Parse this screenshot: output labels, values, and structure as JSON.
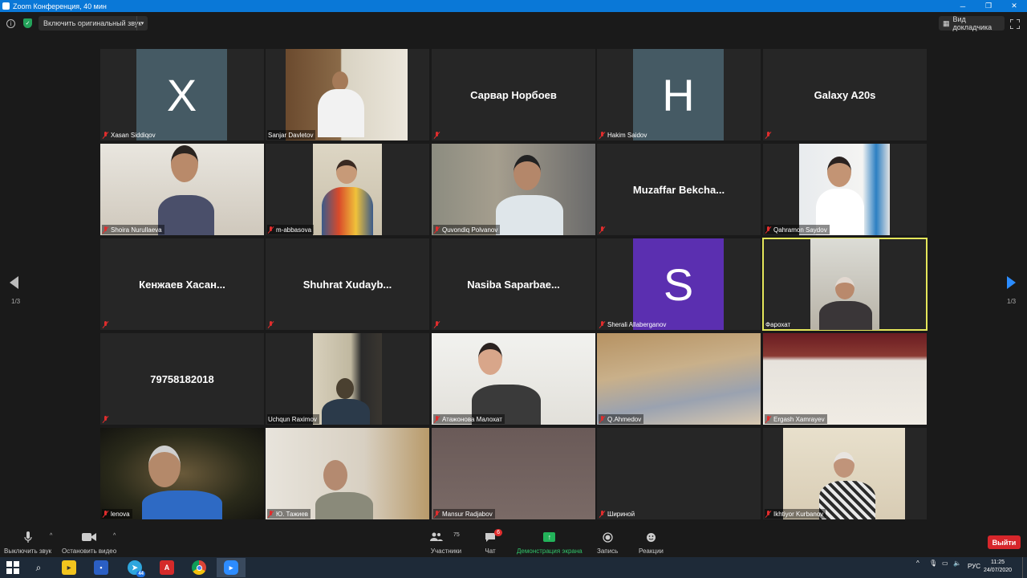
{
  "window": {
    "title": "Zoom Конференция, 40 мин"
  },
  "top_bar": {
    "original_sound_label": "Включить оригинальный звук",
    "view_label": "Вид докладчика"
  },
  "pagination": {
    "left": "1/3",
    "right": "1/3"
  },
  "participants": [
    {
      "name": "Xasan Siddiqov",
      "mode": "avatar",
      "initial": "X",
      "avatar_color": "#455a64",
      "muted": true
    },
    {
      "name": "Sanjar Davletov",
      "mode": "video",
      "muted": false
    },
    {
      "name": "",
      "mode": "name",
      "display": "Сарвар Норбоев",
      "muted": true
    },
    {
      "name": "Hakim Saidov",
      "mode": "avatar",
      "initial": "H",
      "avatar_color": "#455a64",
      "muted": true
    },
    {
      "name": "",
      "mode": "name",
      "display": "Galaxy A20s",
      "muted": true
    },
    {
      "name": "Shoira Nurullaeva",
      "mode": "video",
      "muted": true
    },
    {
      "name": "m-abbasova",
      "mode": "video",
      "muted": true
    },
    {
      "name": "Quvondiq Polvanov",
      "mode": "video",
      "muted": true
    },
    {
      "name": "",
      "mode": "name",
      "display": "Muzaffar  Bekcha...",
      "muted": true
    },
    {
      "name": "Qahramon Saydov",
      "mode": "video",
      "muted": true
    },
    {
      "name": "",
      "mode": "name",
      "display": "Кенжаев  Хасан...",
      "muted": true
    },
    {
      "name": "",
      "mode": "name",
      "display": "Shuhrat  Xudayb...",
      "muted": true
    },
    {
      "name": "",
      "mode": "name",
      "display": "Nasiba  Saparbae...",
      "muted": true
    },
    {
      "name": "Sherali Allaberganov",
      "mode": "avatar",
      "initial": "S",
      "avatar_color": "#5b2fb0",
      "muted": true
    },
    {
      "name": "Фарохат",
      "mode": "video",
      "muted": false,
      "active_speaker": true
    },
    {
      "name": "",
      "mode": "name",
      "display": "79758182018",
      "muted": true
    },
    {
      "name": "Uchqun Raximov",
      "mode": "video",
      "muted": false
    },
    {
      "name": "Атажонова Малохат",
      "mode": "video",
      "muted": true
    },
    {
      "name": "Q.Ahmedov",
      "mode": "video",
      "muted": true
    },
    {
      "name": "Ergash Xamrayev",
      "mode": "video",
      "muted": true
    },
    {
      "name": "lenova",
      "mode": "video",
      "muted": true
    },
    {
      "name": "Ю. Тажиев",
      "mode": "video",
      "muted": true
    },
    {
      "name": "Mansur Radjabov",
      "mode": "video",
      "muted": true
    },
    {
      "name": "Шириной",
      "mode": "video",
      "muted": true
    },
    {
      "name": "Ikhtiyor Kurbanov",
      "mode": "video",
      "muted": true
    }
  ],
  "toolbar": {
    "mute_label": "Выключить звук",
    "video_label": "Остановить видео",
    "participants_label": "Участники",
    "participants_count": "75",
    "chat_label": "Чат",
    "chat_badge": "6",
    "share_label": "Демонстрация экрана",
    "record_label": "Запись",
    "reactions_label": "Реакции",
    "leave_label": "Выйти"
  },
  "taskbar": {
    "telegram_badge": "44",
    "language": "РУС",
    "time": "11:25",
    "date": "24/07/2020"
  },
  "colors": {
    "accent": "#2b8cff",
    "speaker_highlight": "#e4e65a",
    "leave": "#d7262b",
    "share": "#23b35a"
  }
}
